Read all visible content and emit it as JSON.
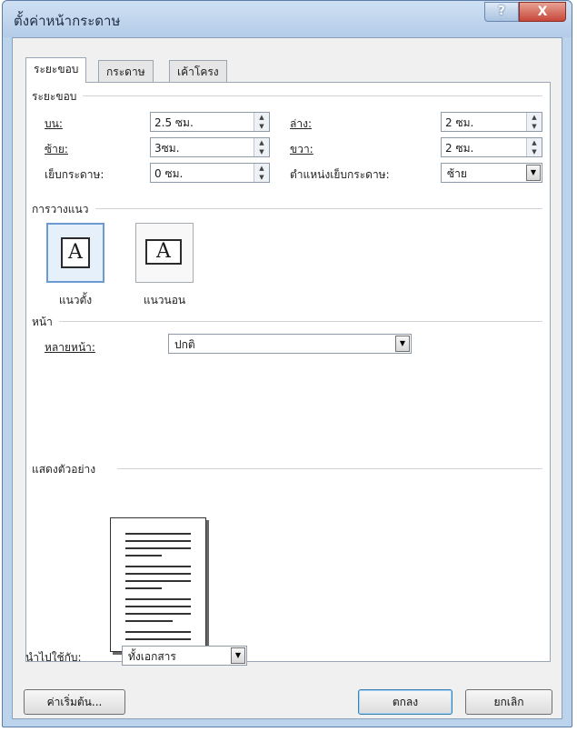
{
  "window": {
    "title": "ตั้งค่าหน้ากระดาษ",
    "help_label": "?",
    "close_label": "X"
  },
  "tabs": [
    {
      "label": "ระยะขอบ",
      "active": true
    },
    {
      "label": "กระดาษ",
      "active": false
    },
    {
      "label": "เค้าโครง",
      "active": false
    }
  ],
  "margins": {
    "section_title": "ระยะขอบ",
    "top_label": "บน:",
    "top_value": "2.5 ซม.",
    "bottom_label": "ล่าง:",
    "bottom_value": "2 ซม.",
    "left_label": "ซ้าย:",
    "left_value": "3ซม.",
    "right_label": "ขวา:",
    "right_value": "2 ซม.",
    "gutter_label": "เย็บกระดาษ:",
    "gutter_value": "0 ซม.",
    "gutter_pos_label": "ตำแหน่งเย็บกระดาษ:",
    "gutter_pos_value": "ซ้าย"
  },
  "orientation": {
    "section_title": "การวางแนว",
    "glyph": "A",
    "portrait_label": "แนวตั้ง",
    "landscape_label": "แนวนอน",
    "selected": "portrait"
  },
  "pages": {
    "section_title": "หน้า",
    "multiple_label": "หลายหน้า:",
    "multiple_value": "ปกติ"
  },
  "preview": {
    "section_title": "แสดงตัวอย่าง"
  },
  "apply": {
    "label": "นำไปใช้กับ:",
    "value": "ทั้งเอกสาร"
  },
  "buttons": {
    "default_label": "ค่าเริ่มต้น...",
    "ok_label": "ตกลง",
    "cancel_label": "ยกเลิก"
  },
  "colors": {
    "titlebar": "#bcd3ec",
    "close": "#c7473a",
    "selected_border": "#6b9bd2"
  }
}
